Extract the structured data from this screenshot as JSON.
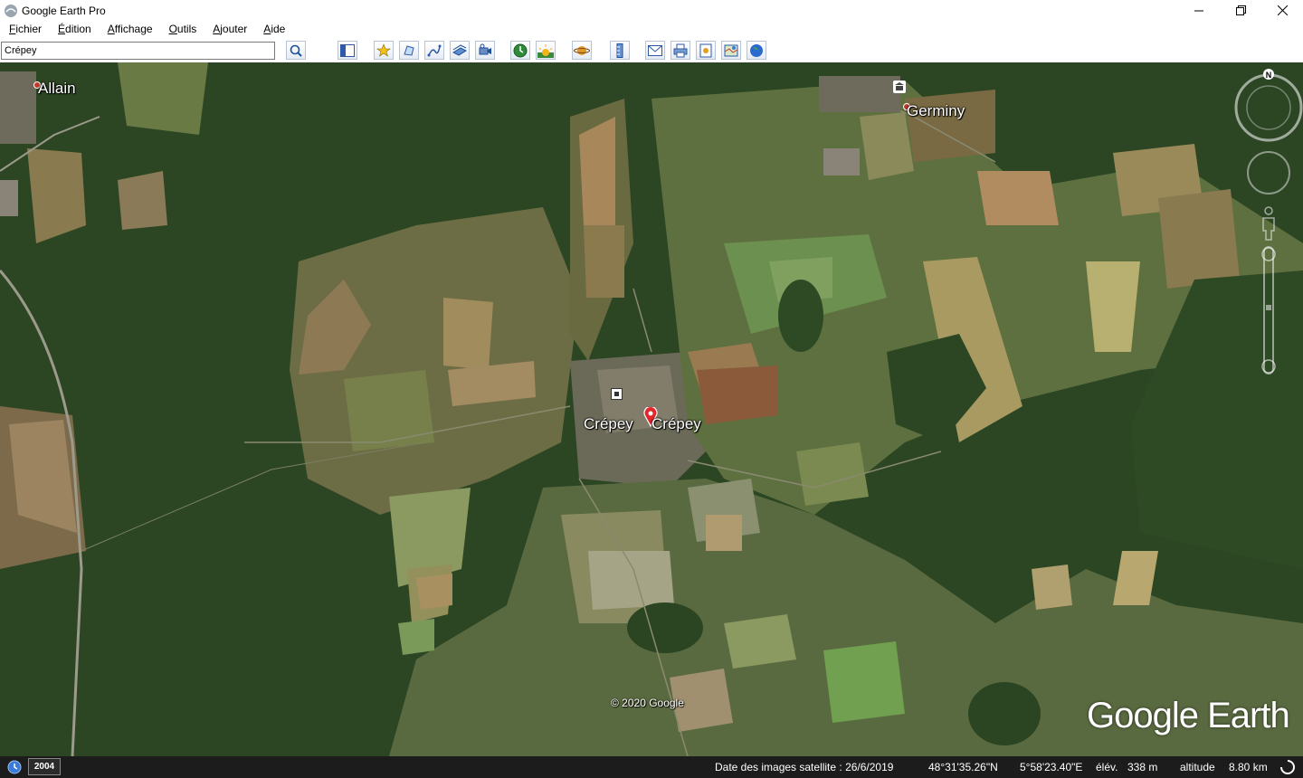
{
  "window": {
    "title": "Google Earth Pro"
  },
  "menu": [
    {
      "acc": "F",
      "rest": "ichier"
    },
    {
      "acc": "É",
      "rest": "dition"
    },
    {
      "acc": "A",
      "rest": "ffichage"
    },
    {
      "acc": "O",
      "rest": "utils"
    },
    {
      "acc": "A",
      "rest": "jouter"
    },
    {
      "acc": "A",
      "rest": "ide"
    }
  ],
  "search": {
    "value": "Crépey"
  },
  "toolbar_icons": [
    "search-icon",
    "sidebar-icon",
    "placemark-icon",
    "polygon-icon",
    "path-icon",
    "overlay-icon",
    "tour-icon",
    "historical-imagery-icon",
    "sunlight-icon",
    "planets-icon",
    "ruler-icon",
    "email-icon",
    "print-icon",
    "save-image-icon",
    "maps-view-icon",
    "earth-view-icon"
  ],
  "map": {
    "labels": {
      "allain": "Allain",
      "germiny": "Germiny",
      "crepey_left": "Crépey",
      "crepey_right": "Crépey"
    },
    "copyright": "© 2020 Google",
    "brand": "Google Earth",
    "compass_letter": "N"
  },
  "status": {
    "year": "2004",
    "image_date": "Date des images satellite : 26/6/2019",
    "latitude": "48°31'35.26\"N",
    "longitude": "5°58'23.40\"E",
    "elev_label": "élév.",
    "elev_value": "338 m",
    "altitude_label": "altitude",
    "altitude_value": "8.80 km"
  },
  "colors": {
    "forest": "#2f4a26",
    "field_light": "#8b8a5a",
    "field_green": "#5d7a3c",
    "statusbar": "#1c1c1c"
  }
}
